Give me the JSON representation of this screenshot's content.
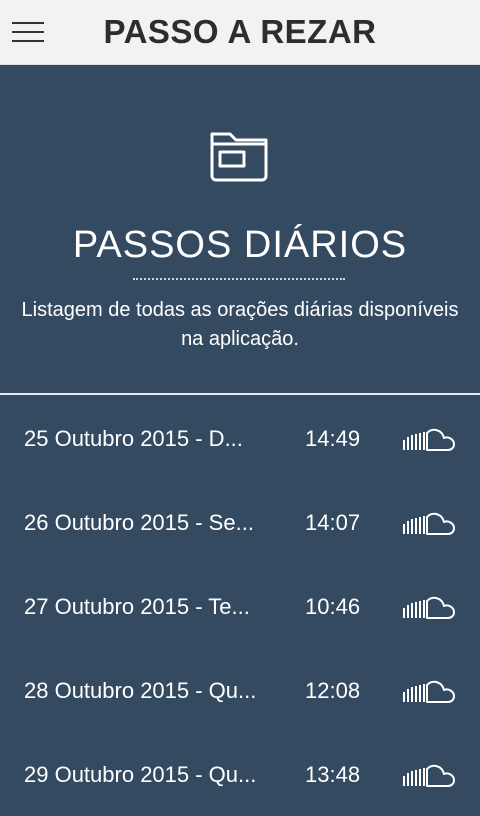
{
  "app": {
    "title": "PASSO A REZAR"
  },
  "hero": {
    "icon": "folder-icon",
    "title": "PASSOS DIÁRIOS",
    "description": "Listagem de todas as orações diárias disponíveis na aplicação."
  },
  "list": [
    {
      "title": "25 Outubro 2015 - D...",
      "time": "14:49",
      "icon": "soundcloud-icon"
    },
    {
      "title": "26 Outubro 2015 - Se...",
      "time": "14:07",
      "icon": "soundcloud-icon"
    },
    {
      "title": "27 Outubro 2015 - Te...",
      "time": "10:46",
      "icon": "soundcloud-icon"
    },
    {
      "title": "28 Outubro 2015 - Qu...",
      "time": "12:08",
      "icon": "soundcloud-icon"
    },
    {
      "title": "29 Outubro 2015 - Qu...",
      "time": "13:48",
      "icon": "soundcloud-icon"
    }
  ],
  "colors": {
    "background": "#344a60",
    "appbar": "#f2f2f2",
    "text": "#ffffff"
  }
}
